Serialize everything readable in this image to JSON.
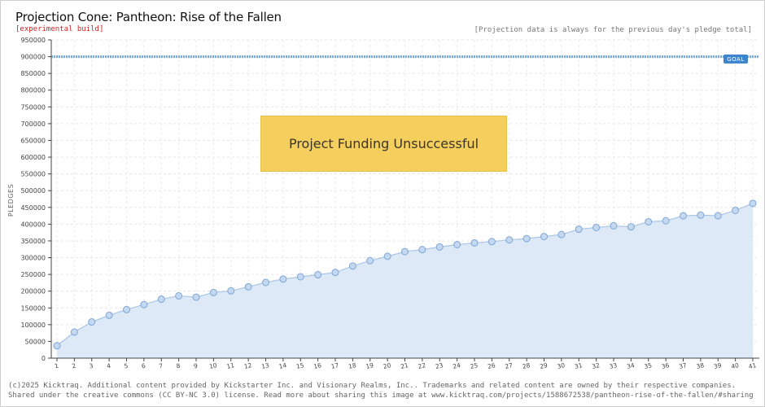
{
  "header": {
    "title": "Projection Cone: Pantheon: Rise of the Fallen",
    "build_tag": "[experimental build]",
    "note": "[Projection data is always for the previous day's pledge total]"
  },
  "status_banner": "Project Funding Unsuccessful",
  "goal_label": "GOAL",
  "footer": {
    "line1": "(c)2025 Kicktraq. Additional content provided by Kickstarter Inc. and Visionary Realms, Inc.. Trademarks and related content are owned by their respective companies.",
    "line2": "Shared under the creative commons (CC BY-NC 3.0) license. Read more about sharing this image at www.kicktraq.com/projects/1588672538/pantheon-rise-of-the-fallen/#sharing"
  },
  "colors": {
    "area_fill": "#dde9f7",
    "line": "#aac6e6",
    "point_fill": "#c4d9f1",
    "point_stroke": "#7ea6d4",
    "goal_line": "#3d86cf",
    "banner": "#f5cf5e"
  },
  "chart_data": {
    "type": "area",
    "ylabel": "PLEDGES",
    "ylim": [
      0,
      950000
    ],
    "yticks": [
      0,
      50000,
      100000,
      150000,
      200000,
      250000,
      300000,
      350000,
      400000,
      450000,
      500000,
      550000,
      600000,
      650000,
      700000,
      750000,
      800000,
      850000,
      900000,
      950000
    ],
    "goal": 900000,
    "grid": true,
    "x": [
      1,
      2,
      3,
      4,
      5,
      6,
      7,
      8,
      9,
      10,
      11,
      12,
      13,
      14,
      15,
      16,
      17,
      18,
      19,
      20,
      21,
      22,
      23,
      24,
      25,
      26,
      27,
      28,
      29,
      30,
      31,
      32,
      33,
      34,
      35,
      36,
      37,
      38,
      39,
      40,
      41
    ],
    "series": [
      {
        "values": [
          37000,
          78000,
          108000,
          128000,
          145000,
          160000,
          176000,
          186000,
          182000,
          196000,
          201000,
          213000,
          226000,
          236000,
          243000,
          249000,
          256000,
          275000,
          291000,
          304000,
          318000,
          324000,
          332000,
          339000,
          344000,
          348000,
          353000,
          357000,
          363000,
          369000,
          385000,
          390000,
          395000,
          392000,
          407000,
          410000,
          425000,
          427000,
          425000,
          441000,
          462000
        ]
      }
    ]
  }
}
